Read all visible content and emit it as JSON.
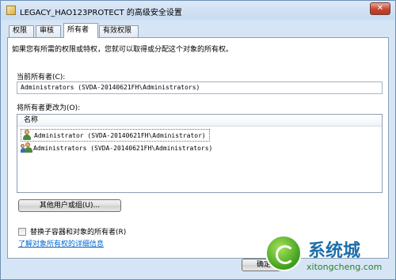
{
  "window": {
    "title": "LEGACY_HAO123PROTECT 的高级安全设置",
    "close_label": "✕"
  },
  "tabs": [
    {
      "label": "权限"
    },
    {
      "label": "审核"
    },
    {
      "label": "所有者"
    },
    {
      "label": "有效权限"
    }
  ],
  "owner_tab": {
    "intro": "如果您有所需的权限或特权，您就可以取得或分配这个对象的所有权。",
    "current_owner_label": "当前所有者(C):",
    "current_owner_value": "Administrators (SVDA-20140621FH\\Administrators)",
    "change_owner_label": "将所有者更改为(O):",
    "list_header": "名称",
    "list_items": [
      {
        "text": "Administrator (SVDA-20140621FH\\Administrator)",
        "icon": "user-icon"
      },
      {
        "text": "Administrators (SVDA-20140621FH\\Administrators)",
        "icon": "group-icon"
      }
    ],
    "other_users_button": "其他用户或组(U)...",
    "replace_checkbox_label": "替换子容器和对象的所有者(R)",
    "replace_checked": false,
    "help_link": "了解对象所有权的详细信息",
    "ok_button": "确定"
  },
  "watermark": {
    "brand": "系统城",
    "url": "xitongcheng.com"
  },
  "colors": {
    "link": "#0066cc",
    "close_button": "#c7452f"
  }
}
